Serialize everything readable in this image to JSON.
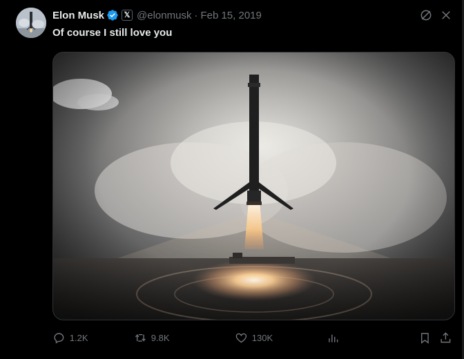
{
  "author": {
    "name": "Elon Musk",
    "handle": "@elonmusk",
    "date": "Feb 15, 2019",
    "badge_label": "𝕏"
  },
  "tweet": {
    "text": "Of course I still love you"
  },
  "actions": {
    "replies": "1.2K",
    "retweets": "9.8K",
    "likes": "130K"
  },
  "colors": {
    "background": "#000000",
    "text_primary": "#e7e9ea",
    "text_secondary": "#71767b",
    "verified": "#1d9bf0",
    "border": "#2f3336"
  },
  "icons": {
    "verified": "verified-badge-icon",
    "grok": "grok-icon",
    "close": "close-icon",
    "reply": "reply-icon",
    "retweet": "retweet-icon",
    "like": "heart-icon",
    "views": "views-icon",
    "bookmark": "bookmark-icon",
    "share": "share-icon"
  }
}
